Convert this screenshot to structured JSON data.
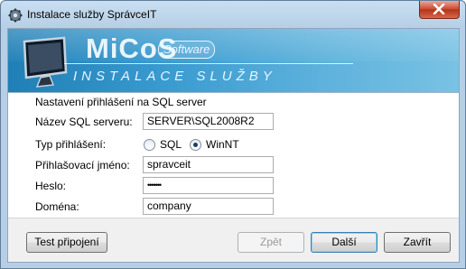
{
  "window": {
    "title": "Instalace služby SprávceIT"
  },
  "banner": {
    "logo": "MiCoS",
    "logo_badge": "Software",
    "subtitle": "INSTALACE SLUŽBY"
  },
  "form": {
    "heading": "Nastavení přihlášení na SQL server",
    "server_label": "Název SQL serveru:",
    "server_value": "SERVER\\SQL2008R2",
    "login_type_label": "Typ přihlášení:",
    "login_options": [
      {
        "label": "SQL",
        "selected": false
      },
      {
        "label": "WinNT",
        "selected": true
      }
    ],
    "username_label": "Přihlašovací jméno:",
    "username_value": "spravceit",
    "password_label": "Heslo:",
    "password_value": "•••••••",
    "domain_label": "Doména:",
    "domain_value": "company"
  },
  "buttons": {
    "test": "Test připojení",
    "back": "Zpět",
    "next": "Další",
    "close": "Zavřít"
  },
  "colors": {
    "banner": "#3a9bd0",
    "title_bar": "#b6cfe6",
    "close_button": "#c9462c"
  }
}
